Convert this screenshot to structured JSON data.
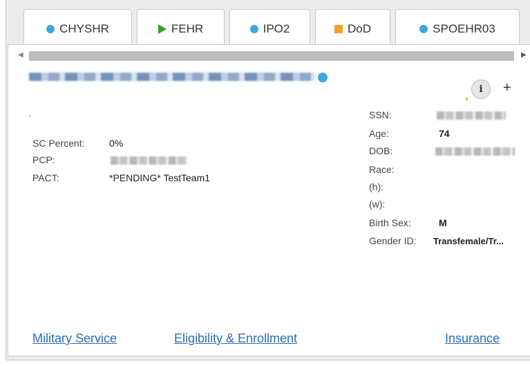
{
  "tabs": [
    {
      "label": "CHYSHR",
      "icon": "dot"
    },
    {
      "label": "FEHR",
      "icon": "triangle"
    },
    {
      "label": "IPO2",
      "icon": "dot"
    },
    {
      "label": "DoD",
      "icon": "square"
    },
    {
      "label": "SPOEHR03",
      "icon": "dot"
    }
  ],
  "colors": {
    "accent_blue": "#3aa7df",
    "green": "#3c9a2c",
    "orange": "#f2a02a",
    "link": "#2a6fb8"
  },
  "patient": {
    "sc_percent_label": "SC Percent:",
    "sc_percent_value": "0%",
    "pcp_label": "PCP:",
    "pact_label": "PACT:",
    "pact_value": "*PENDING* TestTeam1",
    "ssn_label": "SSN:",
    "age_label": "Age:",
    "age_value": "74",
    "dob_label": "DOB:",
    "race_label": "Race:",
    "h_label": "(h):",
    "w_label": "(w):",
    "birth_sex_label": "Birth Sex:",
    "birth_sex_value": "M",
    "gender_id_label": "Gender ID:",
    "gender_id_value": "Transfemale/Tr..."
  },
  "links": {
    "military": "Military Service",
    "eligibility": "Eligibility & Enrollment",
    "insurance": "Insurance"
  },
  "icons": {
    "info": "i",
    "plus": "+"
  }
}
